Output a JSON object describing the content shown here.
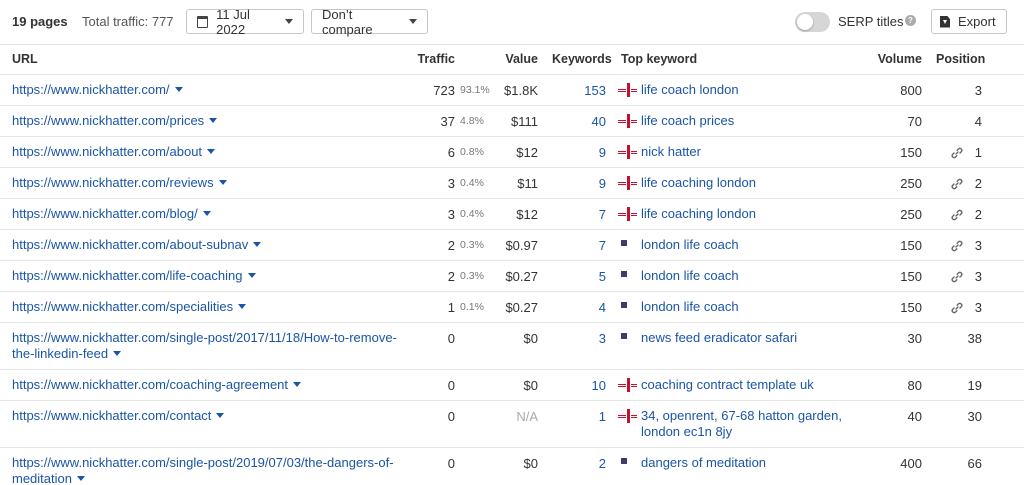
{
  "toolbar": {
    "pages": "19 pages",
    "total_traffic": "Total traffic: 777",
    "date": "11 Jul 2022",
    "compare": "Don’t compare",
    "serp_titles": "SERP titles",
    "export": "Export"
  },
  "columns": {
    "url": "URL",
    "traffic": "Traffic",
    "value": "Value",
    "keywords": "Keywords",
    "top_keyword": "Top keyword",
    "volume": "Volume",
    "position": "Position"
  },
  "rows": [
    {
      "url": "https://www.nickhatter.com/",
      "traffic": "723",
      "pct": "93.1%",
      "value": "$1.8K",
      "keywords": "153",
      "flag": "uk",
      "top_keyword": "life coach london",
      "volume": "800",
      "link": false,
      "position": "3"
    },
    {
      "url": "https://www.nickhatter.com/prices",
      "traffic": "37",
      "pct": "4.8%",
      "value": "$111",
      "keywords": "40",
      "flag": "uk",
      "top_keyword": "life coach prices",
      "volume": "70",
      "link": false,
      "position": "4"
    },
    {
      "url": "https://www.nickhatter.com/about",
      "traffic": "6",
      "pct": "0.8%",
      "value": "$12",
      "keywords": "9",
      "flag": "uk",
      "top_keyword": "nick hatter",
      "volume": "150",
      "link": true,
      "position": "1"
    },
    {
      "url": "https://www.nickhatter.com/reviews",
      "traffic": "3",
      "pct": "0.4%",
      "value": "$11",
      "keywords": "9",
      "flag": "uk",
      "top_keyword": "life coaching london",
      "volume": "250",
      "link": true,
      "position": "2"
    },
    {
      "url": "https://www.nickhatter.com/blog/",
      "traffic": "3",
      "pct": "0.4%",
      "value": "$12",
      "keywords": "7",
      "flag": "uk",
      "top_keyword": "life coaching london",
      "volume": "250",
      "link": true,
      "position": "2"
    },
    {
      "url": "https://www.nickhatter.com/about-subnav",
      "traffic": "2",
      "pct": "0.3%",
      "value": "$0.97",
      "keywords": "7",
      "flag": "us",
      "top_keyword": "london life coach",
      "volume": "150",
      "link": true,
      "position": "3"
    },
    {
      "url": "https://www.nickhatter.com/life-coaching",
      "traffic": "2",
      "pct": "0.3%",
      "value": "$0.27",
      "keywords": "5",
      "flag": "us",
      "top_keyword": "london life coach",
      "volume": "150",
      "link": true,
      "position": "3"
    },
    {
      "url": "https://www.nickhatter.com/specialities",
      "traffic": "1",
      "pct": "0.1%",
      "value": "$0.27",
      "keywords": "4",
      "flag": "us",
      "top_keyword": "london life coach",
      "volume": "150",
      "link": true,
      "position": "3"
    },
    {
      "url": "https://www.nickhatter.com/single-post/2017/11/18/How-to-remove-the-linkedin-feed",
      "traffic": "0",
      "pct": "",
      "value": "$0",
      "keywords": "3",
      "flag": "us",
      "top_keyword": "news feed eradicator safari",
      "volume": "30",
      "link": false,
      "position": "38"
    },
    {
      "url": "https://www.nickhatter.com/coaching-agreement",
      "traffic": "0",
      "pct": "",
      "value": "$0",
      "keywords": "10",
      "flag": "uk",
      "top_keyword": "coaching contract template uk",
      "volume": "80",
      "link": false,
      "position": "19"
    },
    {
      "url": "https://www.nickhatter.com/contact",
      "traffic": "0",
      "pct": "",
      "value": "N/A",
      "keywords": "1",
      "flag": "uk",
      "top_keyword": "34, openrent, 67-68 hatton garden, london ec1n 8jy",
      "volume": "40",
      "link": false,
      "position": "30"
    },
    {
      "url": "https://www.nickhatter.com/single-post/2019/07/03/the-dangers-of-meditation",
      "traffic": "0",
      "pct": "",
      "value": "$0",
      "keywords": "2",
      "flag": "us",
      "top_keyword": "dangers of meditation",
      "volume": "400",
      "link": false,
      "position": "66"
    }
  ]
}
